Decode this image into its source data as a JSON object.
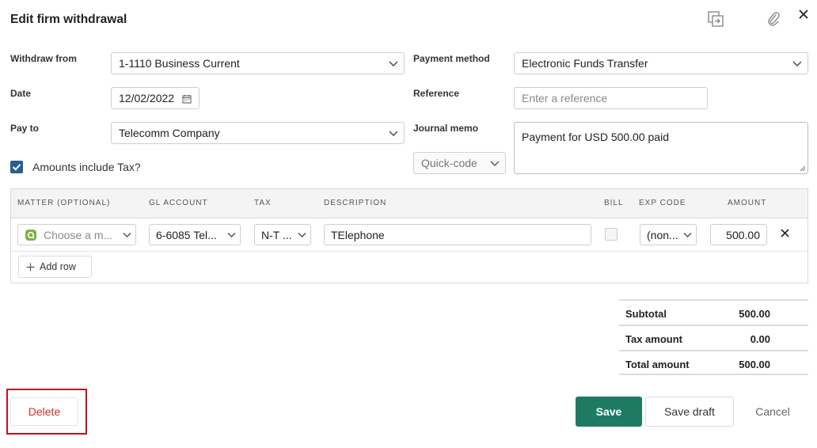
{
  "dialog": {
    "title": "Edit firm withdrawal"
  },
  "header_icons": {
    "duplicate": "duplicate-icon",
    "attach": "paperclip-icon",
    "close": "close-icon"
  },
  "form": {
    "withdraw_from": {
      "label": "Withdraw from",
      "value": "1-1110 Business Current"
    },
    "date": {
      "label": "Date",
      "value": "12/02/2022"
    },
    "pay_to": {
      "label": "Pay to",
      "value": "Telecomm Company"
    },
    "payment_method": {
      "label": "Payment method",
      "value": "Electronic Funds Transfer"
    },
    "reference": {
      "label": "Reference",
      "placeholder": "Enter a reference"
    },
    "journal_memo": {
      "label": "Journal memo",
      "value": "Payment for USD 500.00 paid"
    },
    "quick_code": {
      "value": "Quick-code"
    },
    "amounts_include_tax": {
      "label": "Amounts include Tax?",
      "checked": true
    }
  },
  "table": {
    "headers": {
      "matter": "MATTER (OPTIONAL)",
      "gl_account": "GL ACCOUNT",
      "tax": "TAX",
      "description": "DESCRIPTION",
      "bill": "BILL",
      "exp_code": "EXP CODE",
      "amount": "AMOUNT"
    },
    "rows": [
      {
        "matter_placeholder": "Choose a m...",
        "gl_account": "6-6085 Tel...",
        "tax": "N-T ...",
        "description": "TElephone",
        "bill": false,
        "exp_code": "(non...",
        "amount": "500.00"
      }
    ],
    "add_row_label": "Add row"
  },
  "totals": {
    "subtotal": {
      "label": "Subtotal",
      "value": "500.00"
    },
    "tax_amount": {
      "label": "Tax amount",
      "value": "0.00"
    },
    "total_amount": {
      "label": "Total amount",
      "value": "500.00"
    }
  },
  "footer": {
    "delete_label": "Delete",
    "save_label": "Save",
    "save_draft_label": "Save draft",
    "cancel_label": "Cancel"
  },
  "colors": {
    "primary": "#1f7a63",
    "danger": "#d0302f",
    "highlight": "#c0111f",
    "checkbox": "#2a5d8f"
  }
}
